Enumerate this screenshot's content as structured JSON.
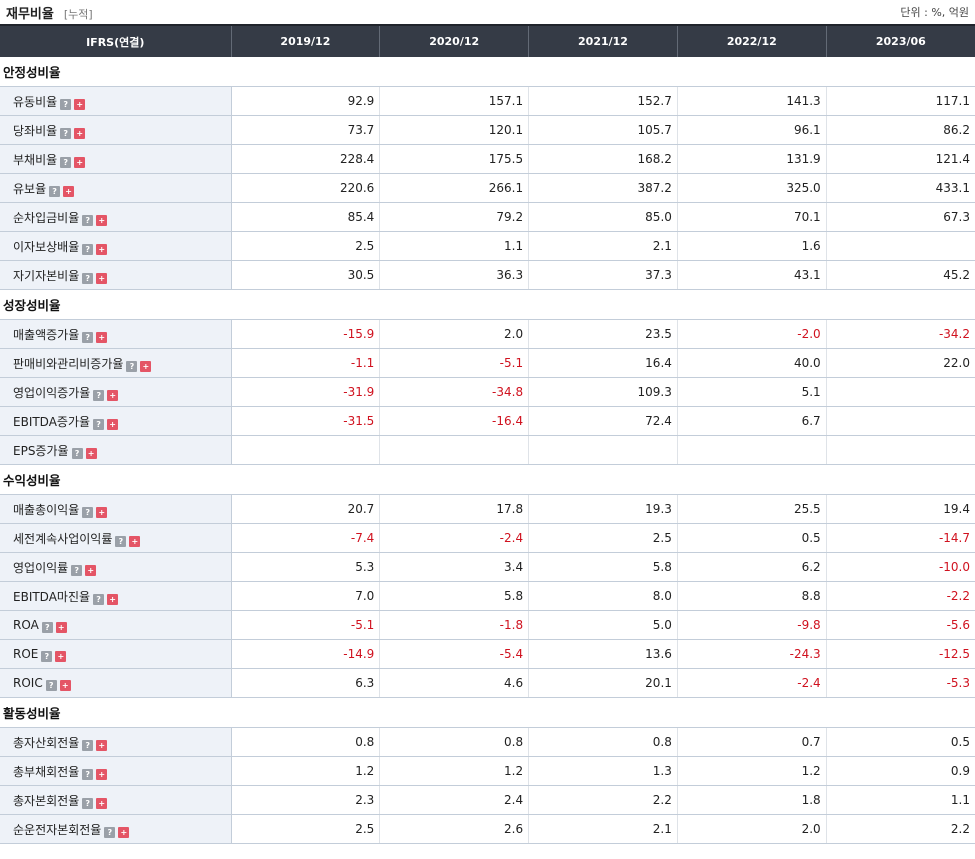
{
  "header": {
    "title": "재무비율",
    "subtitle": "[누적]",
    "unit": "단위 : %, 억원"
  },
  "columns": [
    "IFRS(연결)",
    "2019/12",
    "2020/12",
    "2021/12",
    "2022/12",
    "2023/06"
  ],
  "icons": {
    "help": "?",
    "expand": "+"
  },
  "colors": {
    "negative": "#d0121f",
    "header_bg": "#353b46",
    "label_bg": "#eef2f8"
  },
  "sections": [
    {
      "name": "안정성비율",
      "rows": [
        {
          "label": "유동비율",
          "values": [
            "92.9",
            "157.1",
            "152.7",
            "141.3",
            "117.1"
          ]
        },
        {
          "label": "당좌비율",
          "values": [
            "73.7",
            "120.1",
            "105.7",
            "96.1",
            "86.2"
          ]
        },
        {
          "label": "부채비율",
          "values": [
            "228.4",
            "175.5",
            "168.2",
            "131.9",
            "121.4"
          ]
        },
        {
          "label": "유보율",
          "values": [
            "220.6",
            "266.1",
            "387.2",
            "325.0",
            "433.1"
          ]
        },
        {
          "label": "순차입금비율",
          "values": [
            "85.4",
            "79.2",
            "85.0",
            "70.1",
            "67.3"
          ]
        },
        {
          "label": "이자보상배율",
          "values": [
            "2.5",
            "1.1",
            "2.1",
            "1.6",
            ""
          ]
        },
        {
          "label": "자기자본비율",
          "values": [
            "30.5",
            "36.3",
            "37.3",
            "43.1",
            "45.2"
          ]
        }
      ]
    },
    {
      "name": "성장성비율",
      "rows": [
        {
          "label": "매출액증가율",
          "values": [
            "-15.9",
            "2.0",
            "23.5",
            "-2.0",
            "-34.2"
          ]
        },
        {
          "label": "판매비와관리비증가율",
          "values": [
            "-1.1",
            "-5.1",
            "16.4",
            "40.0",
            "22.0"
          ]
        },
        {
          "label": "영업이익증가율",
          "values": [
            "-31.9",
            "-34.8",
            "109.3",
            "5.1",
            ""
          ]
        },
        {
          "label": "EBITDA증가율",
          "values": [
            "-31.5",
            "-16.4",
            "72.4",
            "6.7",
            ""
          ]
        },
        {
          "label": "EPS증가율",
          "values": [
            "",
            "",
            "",
            "",
            ""
          ]
        }
      ]
    },
    {
      "name": "수익성비율",
      "rows": [
        {
          "label": "매출총이익율",
          "values": [
            "20.7",
            "17.8",
            "19.3",
            "25.5",
            "19.4"
          ]
        },
        {
          "label": "세전계속사업이익률",
          "values": [
            "-7.4",
            "-2.4",
            "2.5",
            "0.5",
            "-14.7"
          ]
        },
        {
          "label": "영업이익률",
          "values": [
            "5.3",
            "3.4",
            "5.8",
            "6.2",
            "-10.0"
          ]
        },
        {
          "label": "EBITDA마진율",
          "values": [
            "7.0",
            "5.8",
            "8.0",
            "8.8",
            "-2.2"
          ]
        },
        {
          "label": "ROA",
          "values": [
            "-5.1",
            "-1.8",
            "5.0",
            "-9.8",
            "-5.6"
          ]
        },
        {
          "label": "ROE",
          "values": [
            "-14.9",
            "-5.4",
            "13.6",
            "-24.3",
            "-12.5"
          ]
        },
        {
          "label": "ROIC",
          "values": [
            "6.3",
            "4.6",
            "20.1",
            "-2.4",
            "-5.3"
          ]
        }
      ]
    },
    {
      "name": "활동성비율",
      "rows": [
        {
          "label": "총자산회전율",
          "values": [
            "0.8",
            "0.8",
            "0.8",
            "0.7",
            "0.5"
          ]
        },
        {
          "label": "총부채회전율",
          "values": [
            "1.2",
            "1.2",
            "1.3",
            "1.2",
            "0.9"
          ]
        },
        {
          "label": "총자본회전율",
          "values": [
            "2.3",
            "2.4",
            "2.2",
            "1.8",
            "1.1"
          ]
        },
        {
          "label": "순운전자본회전율",
          "values": [
            "2.5",
            "2.6",
            "2.1",
            "2.0",
            "2.2"
          ]
        }
      ]
    }
  ]
}
